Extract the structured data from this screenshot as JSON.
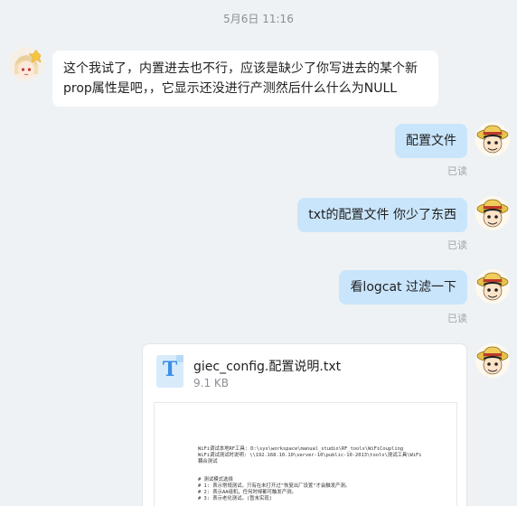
{
  "timestamp": "5月6日 11:16",
  "messages": [
    {
      "side": "left",
      "text": "这个我试了，内置进去也不行，应该是缺少了你写进去的某个新prop属性是吧，，它显示还没进行产测然后什么什么为NULL"
    },
    {
      "side": "right",
      "text": "配置文件",
      "status": "已读"
    },
    {
      "side": "right",
      "text": "txt的配置文件 你少了东西",
      "status": "已读"
    },
    {
      "side": "right",
      "text": "看logcat 过滤一下",
      "status": "已读"
    }
  ],
  "file": {
    "icon_letter": "T",
    "name": "giec_config.配置说明.txt",
    "size": "9.1 KB",
    "preview_lines": [
      "WiFi调试本地RF工具: D:\\sys\\workspace\\manual_studio\\RF_tools\\WiFiCoupling",
      "WiFi调试测试时说明: \\\\192.168.10.10\\server-10\\public-10-2013\\tools\\测试工具\\WiFi",
      "耦合测试",
      "",
      "# 测试模式选择",
      "# 1: 表示常规测试，只有在未打开过\"恢复出厂设置\"才会触发产测。",
      "# 2: 表示AA组机，任何时候都可触发产测。",
      "# 3: 表示老化测试。(暂未实现)"
    ]
  },
  "colors": {
    "background": "#eef2f4",
    "bubble_left": "#ffffff",
    "bubble_right": "#c9e5fc",
    "read_status": "#a0a5aa"
  },
  "icons": {
    "other_avatar": "anime-girl-avatar-icon",
    "self_avatar": "straw-hat-avatar-icon",
    "file": "text-file-icon"
  }
}
